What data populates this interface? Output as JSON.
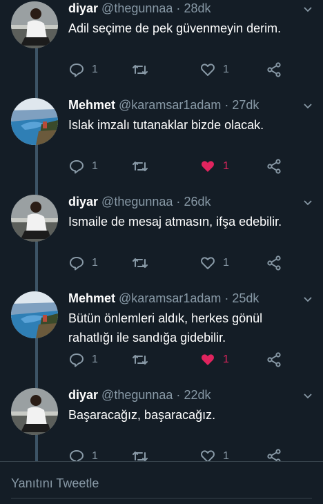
{
  "thread": {
    "tweets": [
      {
        "name": "diyar",
        "handle": "@thegunnaa",
        "time": "28dk",
        "text": "Adil seçime de pek güvenmeyin derim.",
        "reply_count": "1",
        "like_count": "1",
        "liked": false,
        "avatar": "person-on-steps"
      },
      {
        "name": "Mehmet",
        "handle": "@karamsar1adam",
        "time": "27dk",
        "text": "Islak imzalı tutanaklar bizde olacak.",
        "reply_count": "1",
        "like_count": "1",
        "liked": true,
        "avatar": "coastal-landscape"
      },
      {
        "name": "diyar",
        "handle": "@thegunnaa",
        "time": "26dk",
        "text": "Ismaile de mesaj atmasın, ifşa edebilir.",
        "reply_count": "1",
        "like_count": "1",
        "liked": false,
        "avatar": "person-on-steps"
      },
      {
        "name": "Mehmet",
        "handle": "@karamsar1adam",
        "time": "25dk",
        "text": "Bütün önlemleri aldık, herkes gönül rahatlığı ile sandığa gidebilir.",
        "reply_count": "1",
        "like_count": "1",
        "liked": true,
        "avatar": "coastal-landscape"
      },
      {
        "name": "diyar",
        "handle": "@thegunnaa",
        "time": "22dk",
        "text": "Başaracağız, başaracağız.",
        "reply_count": "1",
        "like_count": "1",
        "liked": false,
        "avatar": "person-on-steps"
      }
    ]
  },
  "composer": {
    "placeholder": "Yanıtını Tweetle"
  },
  "colors": {
    "background": "#141d26",
    "muted": "#8899a6",
    "like": "#e0245e",
    "thread_line": "#3d5466"
  }
}
